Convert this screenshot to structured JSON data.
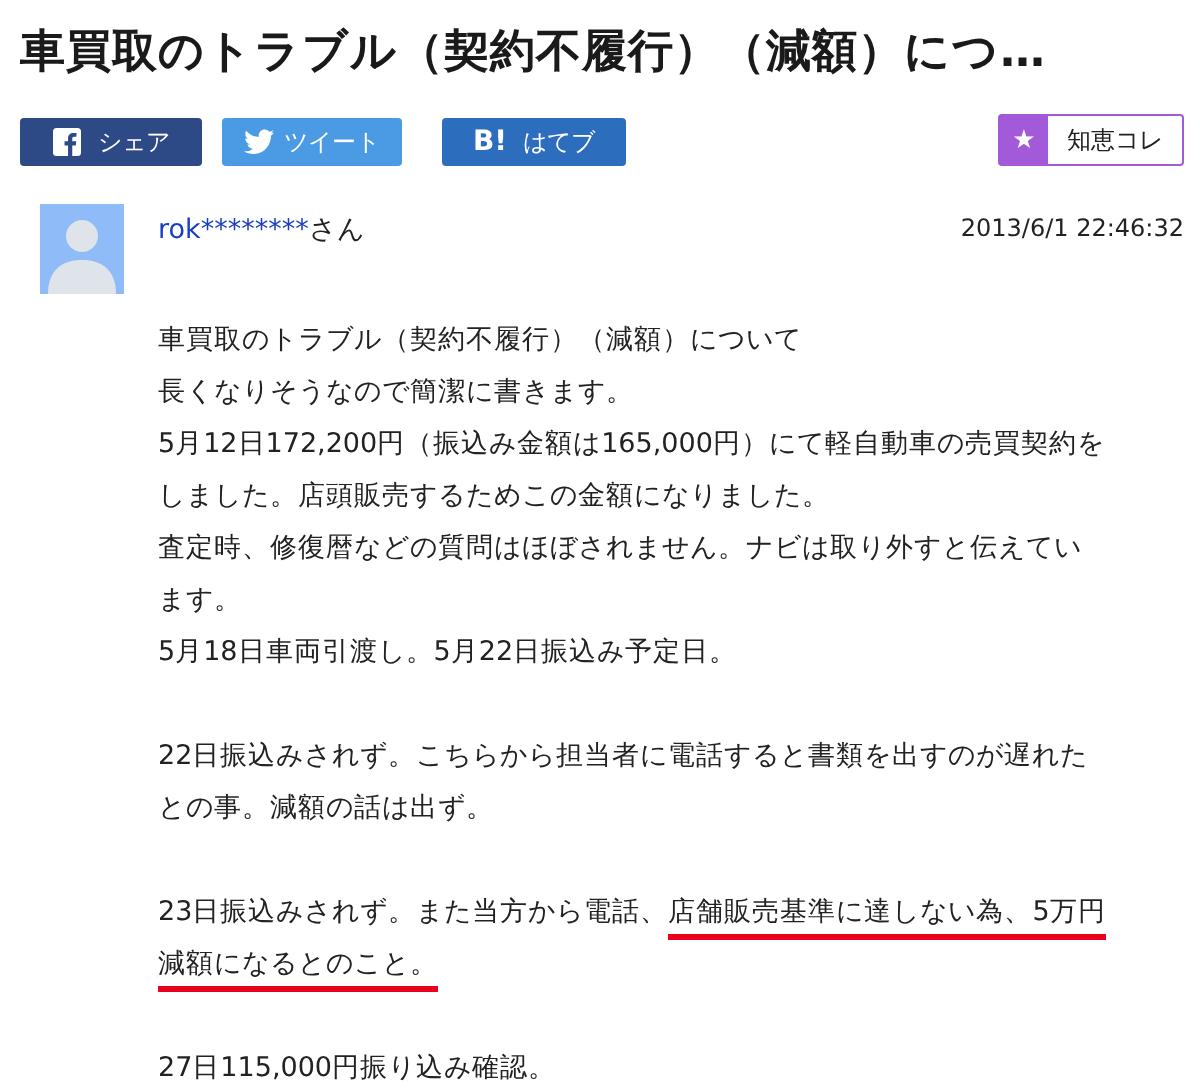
{
  "title": "車買取のトラブル（契約不履行）（減額）につ…",
  "share_buttons": [
    {
      "kind": "facebook",
      "label": "シェア"
    },
    {
      "kind": "twitter",
      "label": "ツイート"
    },
    {
      "kind": "hatena",
      "mark": "B!",
      "label": "はてブ"
    }
  ],
  "collect_button": {
    "mark": "★",
    "label": "知恵コレ"
  },
  "post": {
    "user": "rok********",
    "honorific": "さん",
    "datetime": "2013/6/1  22:46:32",
    "paragraphs": [
      [
        [
          {
            "text": "車買取のトラブル（契約不履行）（減額）について",
            "underlined": false
          }
        ],
        [
          {
            "text": "長くなりそうなので簡潔に書きます。",
            "underlined": false
          }
        ],
        [
          {
            "text": "5月12日172,200円（振込み金額は165,000円）にて軽自動車の売買契約を",
            "underlined": false
          }
        ],
        [
          {
            "text": "しました。店頭販売するためこの金額になりました。",
            "underlined": false
          }
        ],
        [
          {
            "text": "査定時、修復暦などの質問はほぼされません。ナビは取り外すと伝えてい",
            "underlined": false
          }
        ],
        [
          {
            "text": "ます。",
            "underlined": false
          }
        ],
        [
          {
            "text": "5月18日車両引渡し。5月22日振込み予定日。",
            "underlined": false
          }
        ]
      ],
      [
        [
          {
            "text": "22日振込みされず。こちらから担当者に電話すると書類を出すのが遅れた",
            "underlined": false
          }
        ],
        [
          {
            "text": "との事。減額の話は出ず。",
            "underlined": false
          }
        ]
      ],
      [
        [
          {
            "text": "23日振込みされず。また当方から電話、",
            "underlined": false
          },
          {
            "text": "店舗販売基準に達しない為、5万円",
            "underlined": true
          }
        ],
        [
          {
            "text": "減額になるとのこと。",
            "underlined": true
          }
        ]
      ],
      [
        [
          {
            "text": "27日115,000円振り込み確認。",
            "underlined": false
          }
        ]
      ]
    ]
  }
}
